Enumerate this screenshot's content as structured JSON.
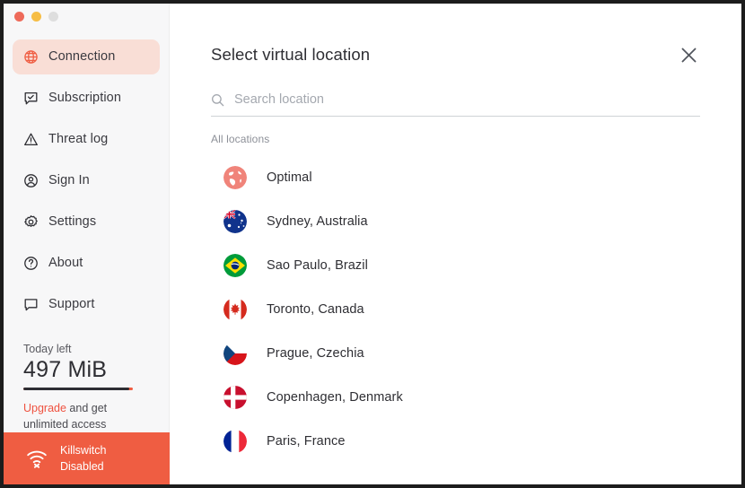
{
  "window": {
    "traffic_lights": [
      {
        "name": "close",
        "color": "#ee6a5a"
      },
      {
        "name": "minimize",
        "color": "#f6bd45"
      },
      {
        "name": "maximize",
        "color": "#dedede"
      }
    ]
  },
  "sidebar": {
    "items": [
      {
        "label": "Connection",
        "icon": "globe-icon",
        "active": true
      },
      {
        "label": "Subscription",
        "icon": "subscription-icon",
        "active": false
      },
      {
        "label": "Threat log",
        "icon": "warning-triangle-icon",
        "active": false
      },
      {
        "label": "Sign In",
        "icon": "user-circle-icon",
        "active": false
      },
      {
        "label": "Settings",
        "icon": "gear-icon",
        "active": false
      },
      {
        "label": "About",
        "icon": "question-circle-icon",
        "active": false
      },
      {
        "label": "Support",
        "icon": "chat-bubble-icon",
        "active": false
      }
    ],
    "quota": {
      "title": "Today left",
      "value": "497 MiB",
      "bar_percent": 97,
      "upgrade_link": "Upgrade",
      "note_rest": " and get unlimited access"
    },
    "killswitch": {
      "title": "Killswitch",
      "status": "Disabled",
      "icon": "wifi-off-icon",
      "color": "#ef5d42"
    }
  },
  "main": {
    "title": "Select virtual location",
    "close_icon": "close-icon",
    "search": {
      "icon": "search-icon",
      "value": "",
      "placeholder": "Search location"
    },
    "group_label": "All locations",
    "locations": [
      {
        "name": "Optimal",
        "flag": "optimal-globe-icon"
      },
      {
        "name": "Sydney, Australia",
        "flag": "flag-australia-icon"
      },
      {
        "name": "Sao Paulo, Brazil",
        "flag": "flag-brazil-icon"
      },
      {
        "name": "Toronto, Canada",
        "flag": "flag-canada-icon"
      },
      {
        "name": "Prague, Czechia",
        "flag": "flag-czechia-icon"
      },
      {
        "name": "Copenhagen, Denmark",
        "flag": "flag-denmark-icon"
      },
      {
        "name": "Paris, France",
        "flag": "flag-france-icon"
      }
    ]
  },
  "colors": {
    "accent": "#ef5d42",
    "accent_soft": "#f9ded6",
    "sidebar_bg": "#f7f7f8",
    "text": "#2e2e33"
  }
}
